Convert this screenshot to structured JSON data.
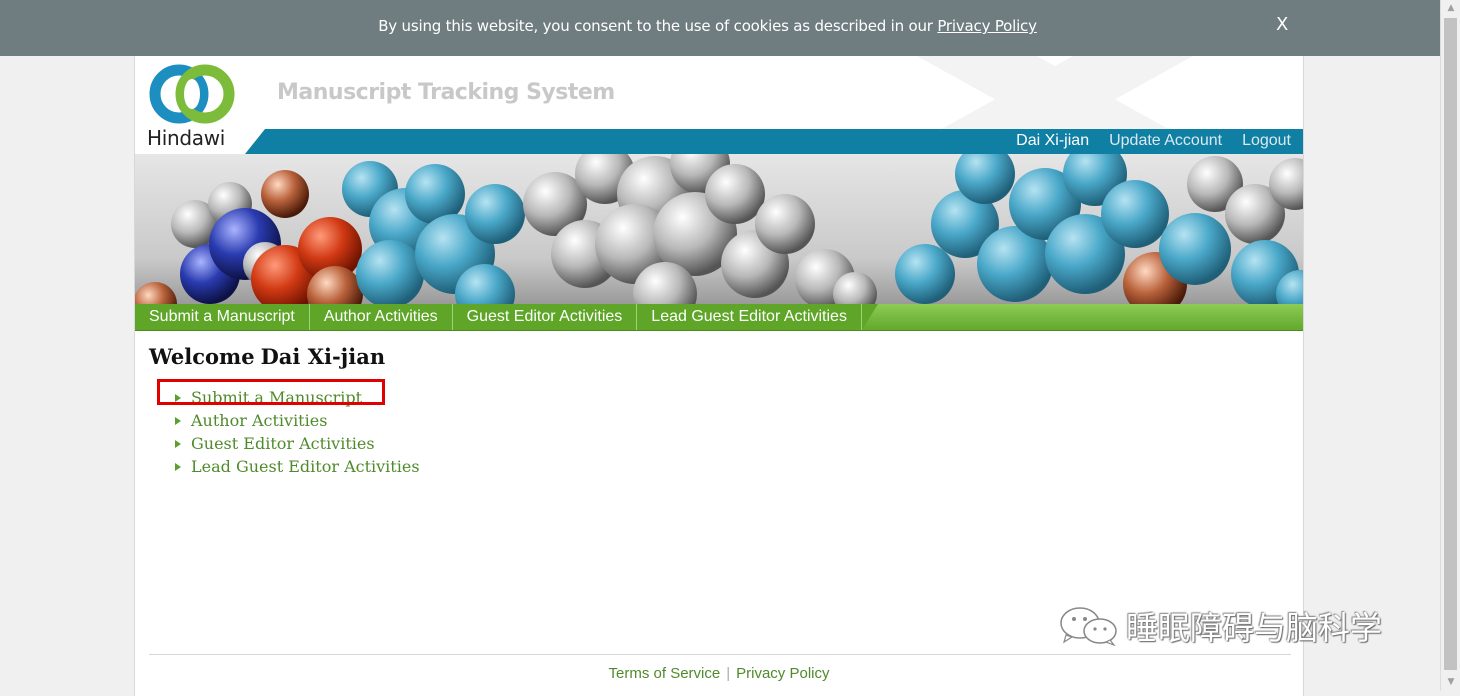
{
  "cookie_bar": {
    "text": "By using this website, you consent to the use of cookies as described in our ",
    "link": "Privacy Policy",
    "close": "X"
  },
  "header": {
    "logo_text": "Hindawi",
    "system_title": "Manuscript Tracking System",
    "user_name": "Dai Xi-jian",
    "update_account": "Update Account",
    "logout": "Logout"
  },
  "nav": {
    "tabs": [
      "Submit a Manuscript",
      "Author Activities",
      "Guest Editor Activities",
      "Lead Guest Editor Activities"
    ]
  },
  "main": {
    "welcome": "Welcome",
    "user_name": "Dai Xi-jian",
    "links": [
      "Submit a Manuscript",
      "Author Activities",
      "Guest Editor Activities",
      "Lead Guest Editor Activities"
    ]
  },
  "footer": {
    "terms": "Terms of Service",
    "privacy": "Privacy Policy"
  },
  "watermark": {
    "text": "睡眠障碍与脑科学"
  },
  "colors": {
    "cookie_bar": "#6f7c80",
    "header_teal": "#0f7fa3",
    "nav_green": "#62a92c",
    "link_green": "#4f8a2b",
    "highlight_red": "#e00000"
  }
}
